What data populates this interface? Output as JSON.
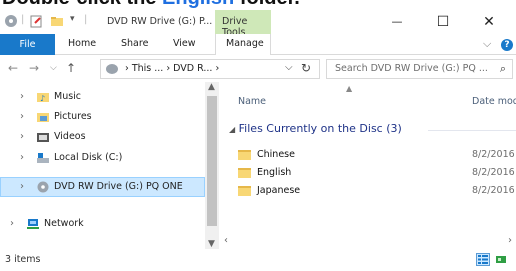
{
  "banner": {
    "prefix": "Double-click the ",
    "highlight": "English",
    "suffix": " folder."
  },
  "window": {
    "title": "DVD RW Drive (G:) P...",
    "context_tab": "Drive Tools",
    "minimize": "—",
    "maximize": "☐",
    "close": "✕"
  },
  "ribbon": {
    "tabs": [
      "File",
      "Home",
      "Share",
      "View",
      "Manage"
    ],
    "expand": "⌵",
    "help": "?"
  },
  "address": {
    "path": "› This ... › DVD R... ›",
    "search_placeholder": "Search DVD RW Drive (G:) PQ ..."
  },
  "nav": {
    "items": [
      {
        "label": "Music",
        "icon": "music-folder-icon"
      },
      {
        "label": "Pictures",
        "icon": "pictures-folder-icon"
      },
      {
        "label": "Videos",
        "icon": "videos-folder-icon"
      },
      {
        "label": "Local Disk (C:)",
        "icon": "local-disk-icon"
      },
      {
        "label": "DVD RW Drive (G:) PQ ONE",
        "icon": "dvd-drive-icon",
        "selected": true
      },
      {
        "label": "Network",
        "icon": "network-icon"
      }
    ]
  },
  "content": {
    "col_name": "Name",
    "col_date": "Date mod",
    "group": "Files Currently on the Disc (3)",
    "rows": [
      {
        "name": "Chinese",
        "date": "8/2/2016"
      },
      {
        "name": "English",
        "date": "8/2/2016"
      },
      {
        "name": "Japanese",
        "date": "8/2/2016"
      }
    ]
  },
  "status": {
    "items": "3 items"
  },
  "colors": {
    "accent": "#1979ca",
    "context_tab": "#cfe8b8",
    "selection": "#cce8ff"
  }
}
